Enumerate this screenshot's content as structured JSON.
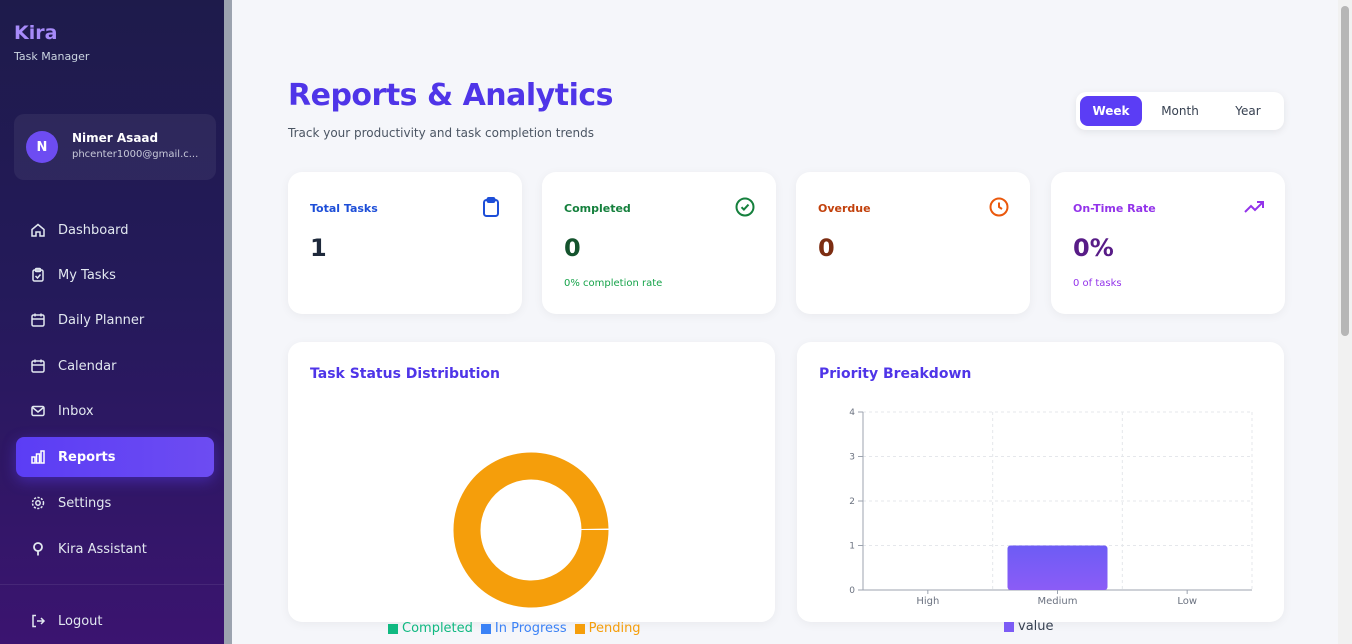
{
  "brand": {
    "name": "Kira",
    "subtitle": "Task Manager"
  },
  "user": {
    "initial": "N",
    "name": "Nimer Asaad",
    "email": "phcenter1000@gmail.c..."
  },
  "nav": [
    {
      "label": "Dashboard",
      "icon": "home-icon"
    },
    {
      "label": "My Tasks",
      "icon": "clipboard-check-icon"
    },
    {
      "label": "Daily Planner",
      "icon": "calendar-icon"
    },
    {
      "label": "Calendar",
      "icon": "calendar-icon"
    },
    {
      "label": "Inbox",
      "icon": "mail-icon"
    },
    {
      "label": "Reports",
      "icon": "bar-chart-icon",
      "active": true
    },
    {
      "label": "Settings",
      "icon": "gear-icon"
    },
    {
      "label": "Kira Assistant",
      "icon": "lightbulb-icon"
    }
  ],
  "logout": {
    "label": "Logout",
    "icon": "logout-icon"
  },
  "header": {
    "title": "Reports & Analytics",
    "subtitle": "Track your productivity and task completion trends"
  },
  "range": {
    "options": [
      "Week",
      "Month",
      "Year"
    ],
    "selected": "Week"
  },
  "stats": [
    {
      "label": "Total Tasks",
      "value": "1",
      "note": "",
      "icon": "clipboard-icon",
      "color": "#1d4ed8",
      "valueColor": "#1e293b"
    },
    {
      "label": "Completed",
      "value": "0",
      "note": "0% completion rate",
      "icon": "check-circle-icon",
      "color": "#15803d",
      "valueColor": "#14532d"
    },
    {
      "label": "Overdue",
      "value": "0",
      "note": "",
      "icon": "clock-icon",
      "color": "#c2410c",
      "valueColor": "#7c2d12"
    },
    {
      "label": "On-Time Rate",
      "value": "0%",
      "note": "0 of tasks",
      "icon": "trending-up-icon",
      "color": "#9333ea",
      "valueColor": "#581c87"
    }
  ],
  "panels": {
    "status_title": "Task Status Distribution",
    "priority_title": "Priority Breakdown"
  },
  "chart_data": [
    {
      "type": "pie",
      "title": "Task Status Distribution",
      "categories": [
        "Completed",
        "In Progress",
        "Pending"
      ],
      "values": [
        0,
        0,
        1
      ],
      "colors": [
        "#10b981",
        "#3b82f6",
        "#f59e0b"
      ],
      "legend": "bottom"
    },
    {
      "type": "bar",
      "title": "Priority Breakdown",
      "categories": [
        "High",
        "Medium",
        "Low"
      ],
      "series": [
        {
          "name": "value",
          "values": [
            0,
            1,
            0
          ],
          "color": "#7c5cf5"
        }
      ],
      "ylim": [
        0,
        4
      ],
      "yticks": [
        "0",
        "1",
        "2",
        "3",
        "4"
      ],
      "grid": true,
      "legend": "bottom"
    }
  ]
}
